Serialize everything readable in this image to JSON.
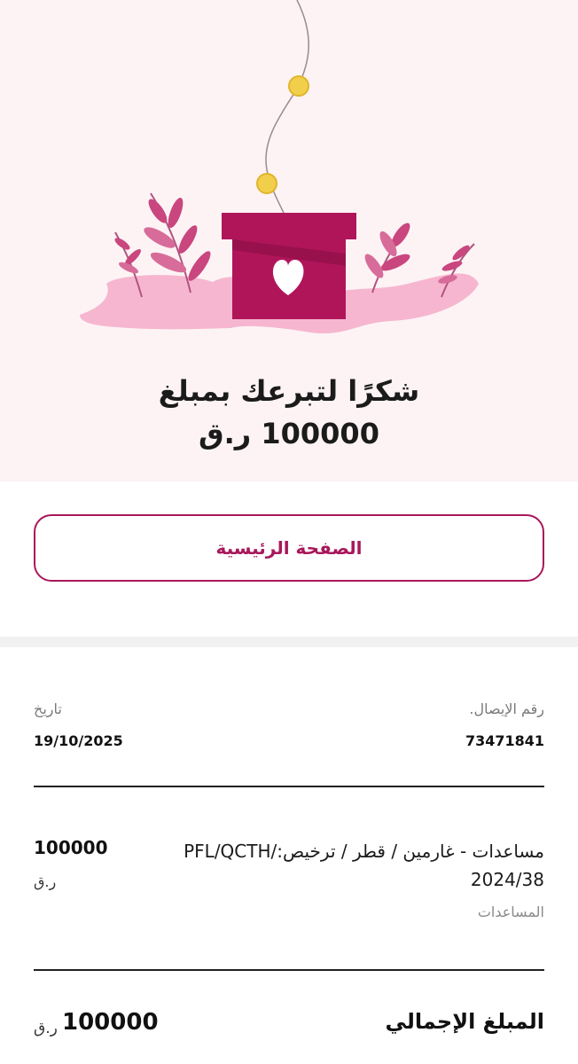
{
  "hero": {
    "thanks_line1": "شكرًا لتبرعك بمبلغ",
    "thanks_line2": "100000 ر.ق"
  },
  "home_button": {
    "label": "الصفحة الرئيسية"
  },
  "receipt": {
    "receipt_no_label": "رقم الإيصال.",
    "receipt_no_value": "73471841",
    "date_label": "تاريخ",
    "date_value": "19/10/2025"
  },
  "item": {
    "description_line1": "مساعدات - غارمين / قطر / ترخيص:/PFL/QCTH",
    "description_line2": "2024/38",
    "category": "المساعدات",
    "amount": "100000",
    "currency": "ر.ق"
  },
  "total": {
    "label": "المبلغ الإجمالي",
    "amount": "100000",
    "currency": "ر.ق"
  },
  "colors": {
    "accent": "#a8175b",
    "box": "#b0155a",
    "hero_bg": "#fdf3f4",
    "blob": "#f6b6cf",
    "coin": "#f2cf4a"
  }
}
